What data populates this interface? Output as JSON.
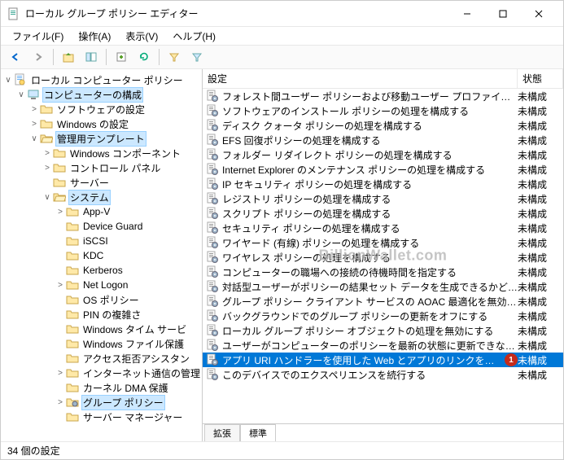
{
  "window": {
    "title": "ローカル グループ ポリシー エディター"
  },
  "menu": {
    "file": "ファイル(F)",
    "action": "操作(A)",
    "view": "表示(V)",
    "help": "ヘルプ(H)"
  },
  "tree": {
    "root": "ローカル コンピューター ポリシー",
    "computer_config": "コンピューターの構成",
    "software": "ソフトウェアの設定",
    "windows": "Windows の設定",
    "admin_templates": "管理用テンプレート",
    "win_components": "Windows コンポーネント",
    "control_panel": "コントロール パネル",
    "server": "サーバー",
    "system": "システム",
    "appv": "App-V",
    "device_guard": "Device Guard",
    "iscsi": "iSCSI",
    "kdc": "KDC",
    "kerberos": "Kerberos",
    "net_logon": "Net Logon",
    "os_policy": "OS ポリシー",
    "pin": "PIN の複雑さ",
    "win_time": "Windows タイム サービ",
    "win_file_protect": "Windows ファイル保護",
    "access_denied": "アクセス拒否アシスタン",
    "internet_mgmt": "インターネット通信の管理",
    "kernel_dma": "カーネル DMA 保護",
    "group_policy": "グループ ポリシー",
    "server_manager": "サーバー マネージャー"
  },
  "list": {
    "header_name": "設定",
    "header_state": "状態",
    "items": [
      {
        "name": "フォレスト間ユーザー ポリシーおよび移動ユーザー プロファイルを許可する",
        "state": "未構成"
      },
      {
        "name": "ソフトウェアのインストール ポリシーの処理を構成する",
        "state": "未構成"
      },
      {
        "name": "ディスク クォータ ポリシーの処理を構成する",
        "state": "未構成"
      },
      {
        "name": "EFS 回復ポリシーの処理を構成する",
        "state": "未構成"
      },
      {
        "name": "フォルダー リダイレクト ポリシーの処理を構成する",
        "state": "未構成"
      },
      {
        "name": "Internet Explorer のメンテナンス ポリシーの処理を構成する",
        "state": "未構成"
      },
      {
        "name": "IP セキュリティ ポリシーの処理を構成する",
        "state": "未構成"
      },
      {
        "name": "レジストリ ポリシーの処理を構成する",
        "state": "未構成"
      },
      {
        "name": "スクリプト ポリシーの処理を構成する",
        "state": "未構成"
      },
      {
        "name": "セキュリティ ポリシーの処理を構成する",
        "state": "未構成"
      },
      {
        "name": "ワイヤード (有線) ポリシーの処理を構成する",
        "state": "未構成"
      },
      {
        "name": "ワイヤレス ポリシーの処理を構成する",
        "state": "未構成"
      },
      {
        "name": "コンピューターの職場への接続の待機時間を指定する",
        "state": "未構成"
      },
      {
        "name": "対話型ユーザーがポリシーの結果セット データを生成できるかどうかを…",
        "state": "未構成"
      },
      {
        "name": "グループ ポリシー クライアント サービスの AOAC 最適化を無効にする",
        "state": "未構成"
      },
      {
        "name": "バックグラウンドでのグループ ポリシーの更新をオフにする",
        "state": "未構成"
      },
      {
        "name": "ローカル グループ ポリシー オブジェクトの処理を無効にする",
        "state": "未構成"
      },
      {
        "name": "ユーザーがコンピューターのポリシーを最新の状態に更新できないように…",
        "state": "未構成"
      },
      {
        "name": "アプリ URI ハンドラーを使用した Web とアプリのリンクを構成します",
        "state": "未構成",
        "selected": true,
        "badge": "1"
      },
      {
        "name": "このデバイスでのエクスペリエンスを続行する",
        "state": "未構成"
      }
    ]
  },
  "tabs": {
    "extended": "拡張",
    "standard": "標準"
  },
  "status": {
    "text": "34 個の設定"
  },
  "watermark": "BillionWallet.com"
}
